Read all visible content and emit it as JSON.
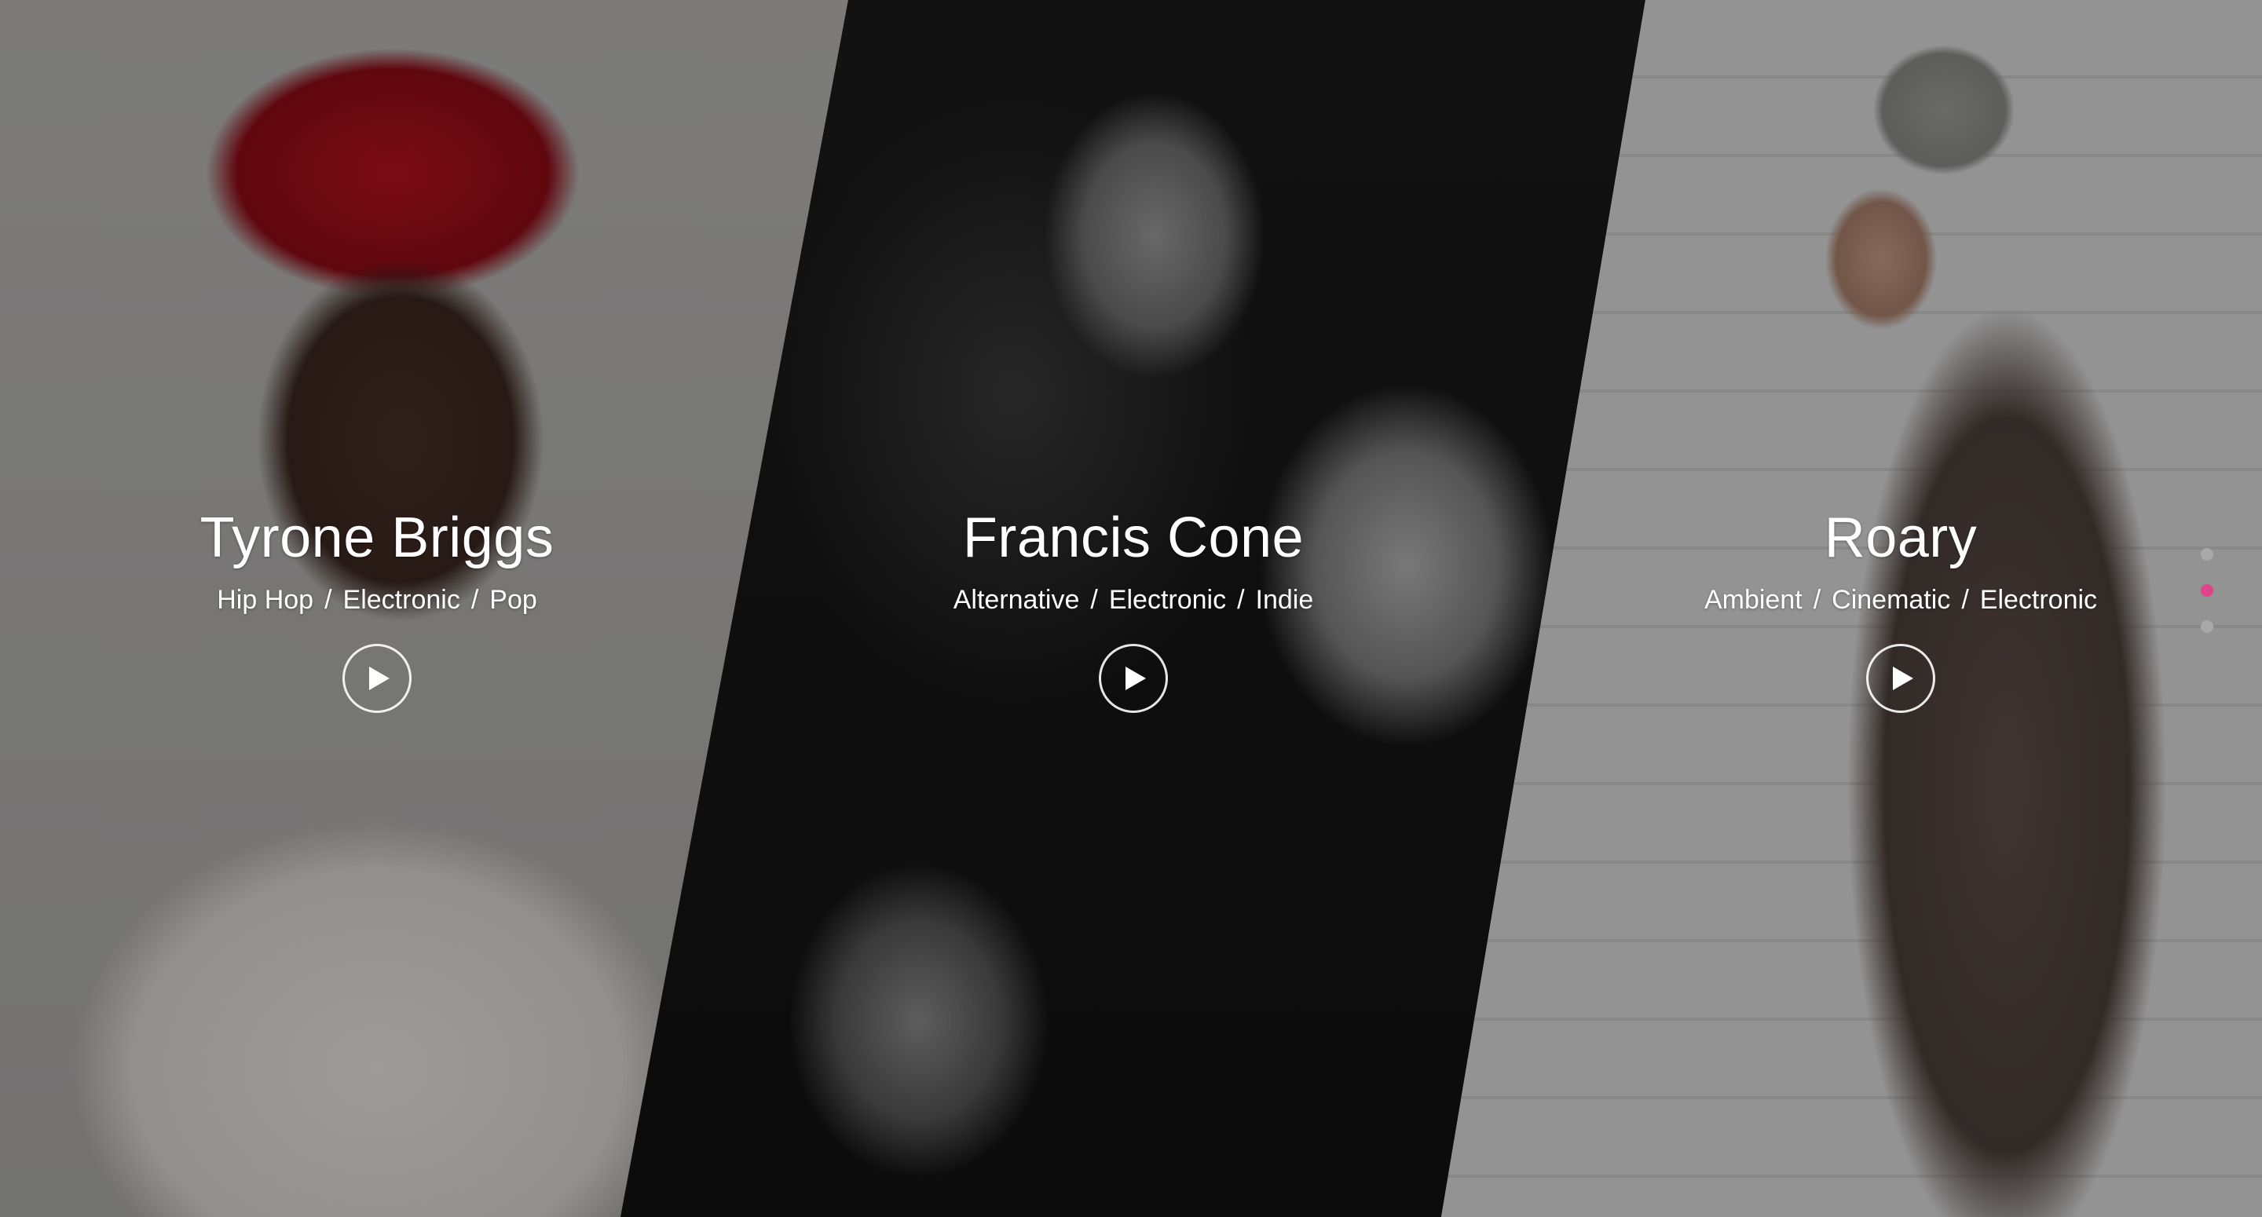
{
  "artists": [
    {
      "name": "Tyrone Briggs",
      "genres": [
        "Hip Hop",
        "Electronic",
        "Pop"
      ],
      "play_icon": "play-icon"
    },
    {
      "name": "Francis Cone",
      "genres": [
        "Alternative",
        "Electronic",
        "Indie"
      ],
      "play_icon": "play-icon"
    },
    {
      "name": "Roary",
      "genres": [
        "Ambient",
        "Cinematic",
        "Electronic"
      ],
      "play_icon": "play-icon"
    }
  ],
  "genre_separator": "/",
  "pagination": {
    "count": 3,
    "active_index": 1,
    "active_color": "#e0448b",
    "inactive_color": "#a9a9a9"
  }
}
